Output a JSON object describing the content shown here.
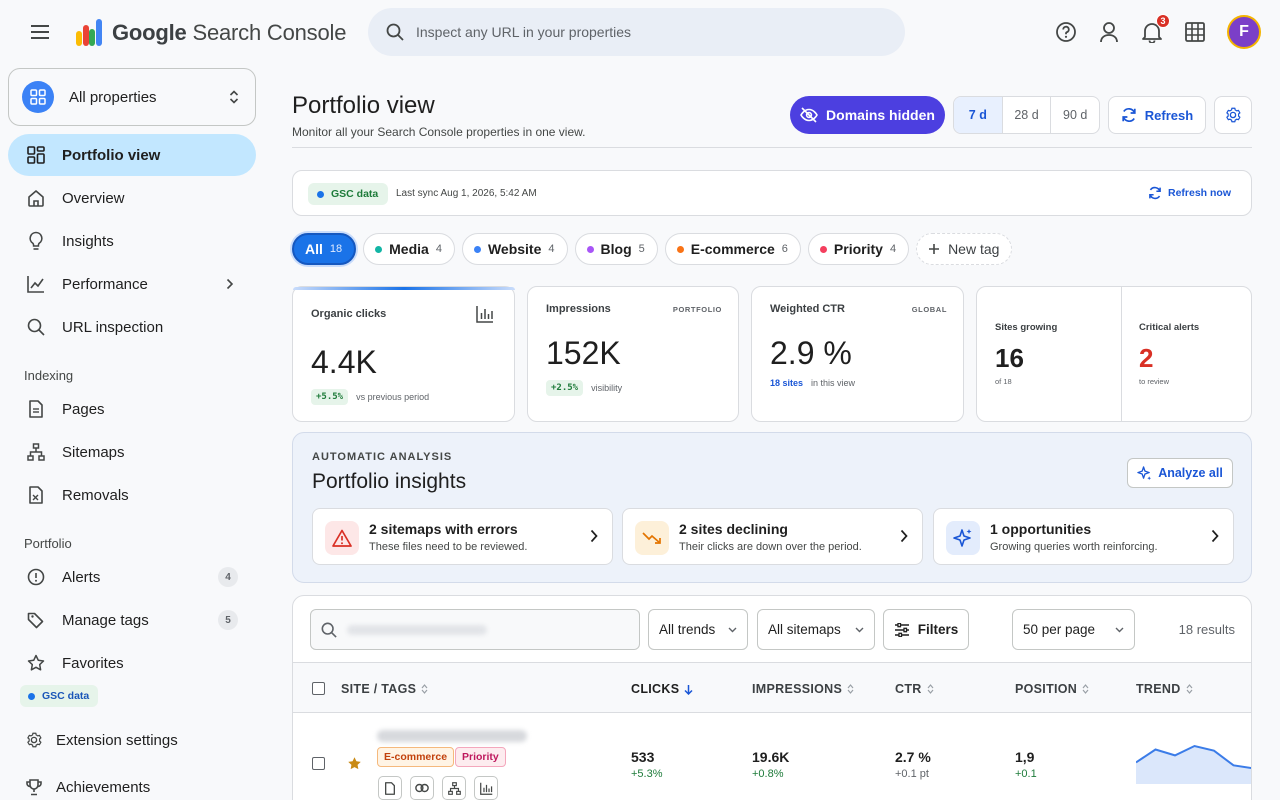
{
  "app": {
    "name_bold": "Google",
    "name_rest": " Search Console",
    "search_placeholder": "Inspect any URL in your properties",
    "notification_count": "3",
    "avatar_letter": "F",
    "colors": {
      "accent": "#1a73e8",
      "primary_button": "#4c3fe0",
      "active_nav": "#c2e7ff",
      "avatar": "#7b3fc8"
    }
  },
  "sidebar": {
    "property_selector": "All properties",
    "items": [
      {
        "label": "Portfolio view",
        "icon": "dashboard-icon",
        "active": true
      },
      {
        "label": "Overview",
        "icon": "home-icon"
      },
      {
        "label": "Insights",
        "icon": "lightbulb-icon"
      },
      {
        "label": "Performance",
        "icon": "chart-line-icon"
      },
      {
        "label": "URL inspection",
        "icon": "search-icon"
      }
    ],
    "section_indexing": "Indexing",
    "indexing_items": [
      {
        "label": "Pages",
        "icon": "document-icon"
      },
      {
        "label": "Sitemaps",
        "icon": "sitemap-icon"
      },
      {
        "label": "Removals",
        "icon": "removal-icon"
      }
    ],
    "section_portfolio": "Portfolio",
    "portfolio_items": [
      {
        "label": "Alerts",
        "icon": "alert-icon",
        "count": "4"
      },
      {
        "label": "Manage tags",
        "icon": "tag-icon",
        "count": "5"
      },
      {
        "label": "Favorites",
        "icon": "star-icon"
      }
    ],
    "gsc_chip": "GSC data",
    "footer_items": [
      {
        "label": "Extension settings",
        "icon": "gear-icon"
      },
      {
        "label": "Achievements",
        "icon": "trophy-icon"
      }
    ]
  },
  "page": {
    "title": "Portfolio view",
    "subtitle": "Monitor all your Search Console properties in one view.",
    "domains_button": "Domains hidden",
    "ranges": [
      "7 d",
      "28 d",
      "90 d"
    ],
    "selected_range": "7 d",
    "refresh_button": "Refresh"
  },
  "sync": {
    "chip": "GSC data",
    "text": "Last sync Aug 1, 2026, 5:42 AM",
    "refresh_now": "Refresh now"
  },
  "tags": [
    {
      "label": "All",
      "count": "18",
      "color": ""
    },
    {
      "label": "Media",
      "count": "4",
      "color": "#12b5a5"
    },
    {
      "label": "Website",
      "count": "4",
      "color": "#3b82f6"
    },
    {
      "label": "Blog",
      "count": "5",
      "color": "#a855f7"
    },
    {
      "label": "E-commerce",
      "count": "6",
      "color": "#f97316"
    },
    {
      "label": "Priority",
      "count": "4",
      "color": "#f43f5e"
    }
  ],
  "new_tag": "New tag",
  "kpis": {
    "clicks": {
      "title": "Organic clicks",
      "value": "4.4K",
      "delta": "+5.5%",
      "note": "vs previous period"
    },
    "impressions": {
      "title": "Impressions",
      "tag": "PORTFOLIO",
      "value": "152K",
      "delta": "+2.5%",
      "note": "visibility"
    },
    "ctr": {
      "title": "Weighted CTR",
      "tag": "GLOBAL",
      "value": "2.9 %",
      "link": "18 sites",
      "note": "in this view"
    },
    "growing": {
      "title": "Sites growing",
      "value": "16",
      "note": "of 18"
    },
    "alerts": {
      "title": "Critical alerts",
      "value": "2",
      "note": "to review"
    }
  },
  "insights": {
    "kicker": "AUTOMATIC ANALYSIS",
    "title": "Portfolio insights",
    "analyze_button": "Analyze all",
    "cards": [
      {
        "title": "2 sitemaps with errors",
        "subtitle": "These files need to be reviewed.",
        "icon": "warning-icon"
      },
      {
        "title": "2 sites declining",
        "subtitle": "Their clicks are down over the period.",
        "icon": "trend-down-icon"
      },
      {
        "title": "1 opportunities",
        "subtitle": "Growing queries worth reinforcing.",
        "icon": "sparkle-icon"
      }
    ]
  },
  "table": {
    "filters": {
      "trends": "All trends",
      "sitemaps": "All sitemaps",
      "filters": "Filters",
      "per_page": "50 per page"
    },
    "results": "18 results",
    "headers": {
      "site": "SITE / TAGS",
      "clicks": "CLICKS",
      "impressions": "IMPRESSIONS",
      "ctr": "CTR",
      "position": "POSITION",
      "trend": "TREND"
    },
    "rows": [
      {
        "tags": [
          "E-commerce",
          "Priority"
        ],
        "clicks": "533",
        "clicks_delta": "+5.3%",
        "impressions": "19.6K",
        "impressions_delta": "+0.8%",
        "ctr": "2.7 %",
        "ctr_delta": "+0.1 pt",
        "position": "1,9",
        "position_delta": "+0.1",
        "trend": [
          30,
          52,
          42,
          58,
          50,
          25,
          20
        ]
      }
    ]
  }
}
